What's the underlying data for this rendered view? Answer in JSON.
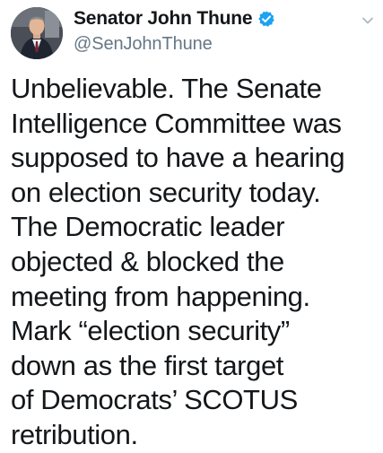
{
  "author": {
    "display_name": "Senator John Thune",
    "handle": "@SenJohnThune",
    "verified": true
  },
  "tweet": {
    "lines": [
      "Unbelievable. The Senate",
      "Intelligence Committee was",
      "supposed to have a hearing",
      "on election security today.",
      "The Democratic leader",
      "objected & blocked the",
      "meeting from happening.",
      "Mark “election security”",
      "down as the first target",
      "of Democrats’ SCOTUS",
      "retribution."
    ]
  },
  "icons": {
    "verified": "verified-badge-icon",
    "menu": "chevron-down-icon"
  },
  "colors": {
    "verified_blue": "#1da1f2",
    "text_primary": "#14171a",
    "text_secondary": "#657786"
  }
}
